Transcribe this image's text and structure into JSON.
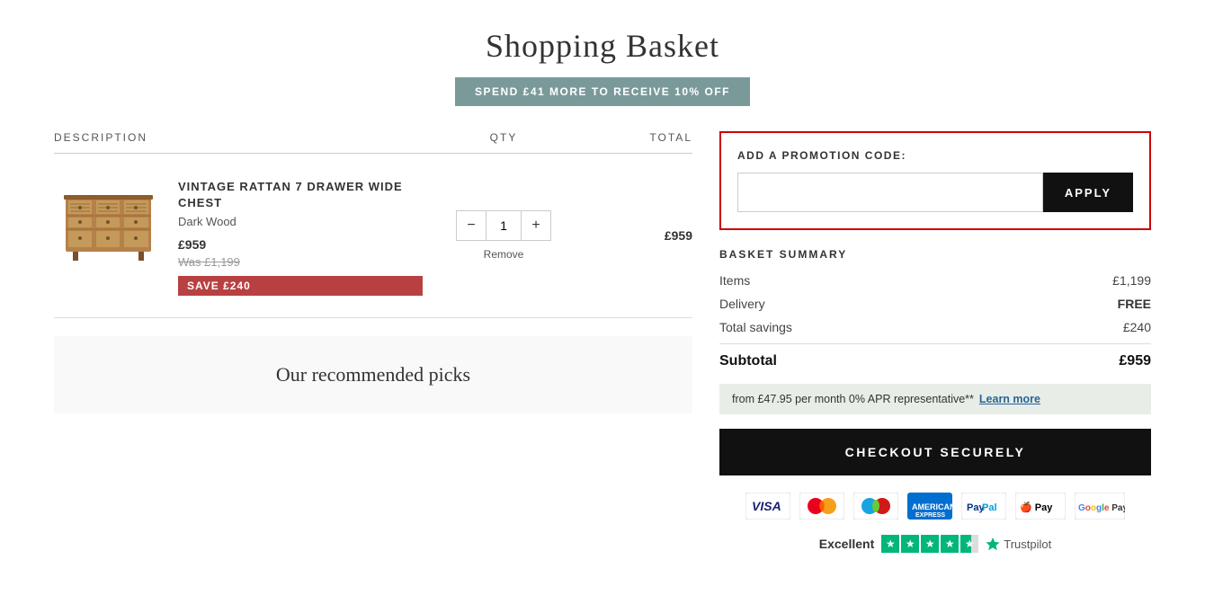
{
  "page": {
    "title": "Shopping Basket"
  },
  "promo_banner": {
    "text": "SPEND £41 MORE TO RECEIVE 10% OFF"
  },
  "table": {
    "headers": {
      "description": "DESCRIPTION",
      "qty": "QTY",
      "total": "TOTAL"
    }
  },
  "product": {
    "name": "VINTAGE RATTAN 7 DRAWER WIDE CHEST",
    "variant": "Dark Wood",
    "price_current": "£959",
    "price_was": "Was £1,199",
    "save_label": "SAVE £240",
    "quantity": "1",
    "total": "£959",
    "remove_label": "Remove"
  },
  "recommended": {
    "title": "Our recommended picks"
  },
  "promo_code": {
    "label": "ADD A PROMOTION CODE:",
    "placeholder": "",
    "apply_button": "APPLY"
  },
  "basket_summary": {
    "title": "BASKET SUMMARY",
    "items_label": "Items",
    "items_value": "£1,199",
    "delivery_label": "Delivery",
    "delivery_value": "FREE",
    "savings_label": "Total savings",
    "savings_value": "£240",
    "subtotal_label": "Subtotal",
    "subtotal_value": "£959"
  },
  "finance": {
    "text": "from £47.95 per month 0% APR representative**",
    "learn_more": "Learn more"
  },
  "checkout": {
    "button_label": "CHECKOUT SECURELY"
  },
  "payment_methods": [
    "VISA",
    "Mastercard",
    "Maestro",
    "AMEX",
    "PayPal",
    "Apple Pay",
    "Google Pay"
  ],
  "trustpilot": {
    "label": "Excellent",
    "logo": "Trustpilot"
  }
}
